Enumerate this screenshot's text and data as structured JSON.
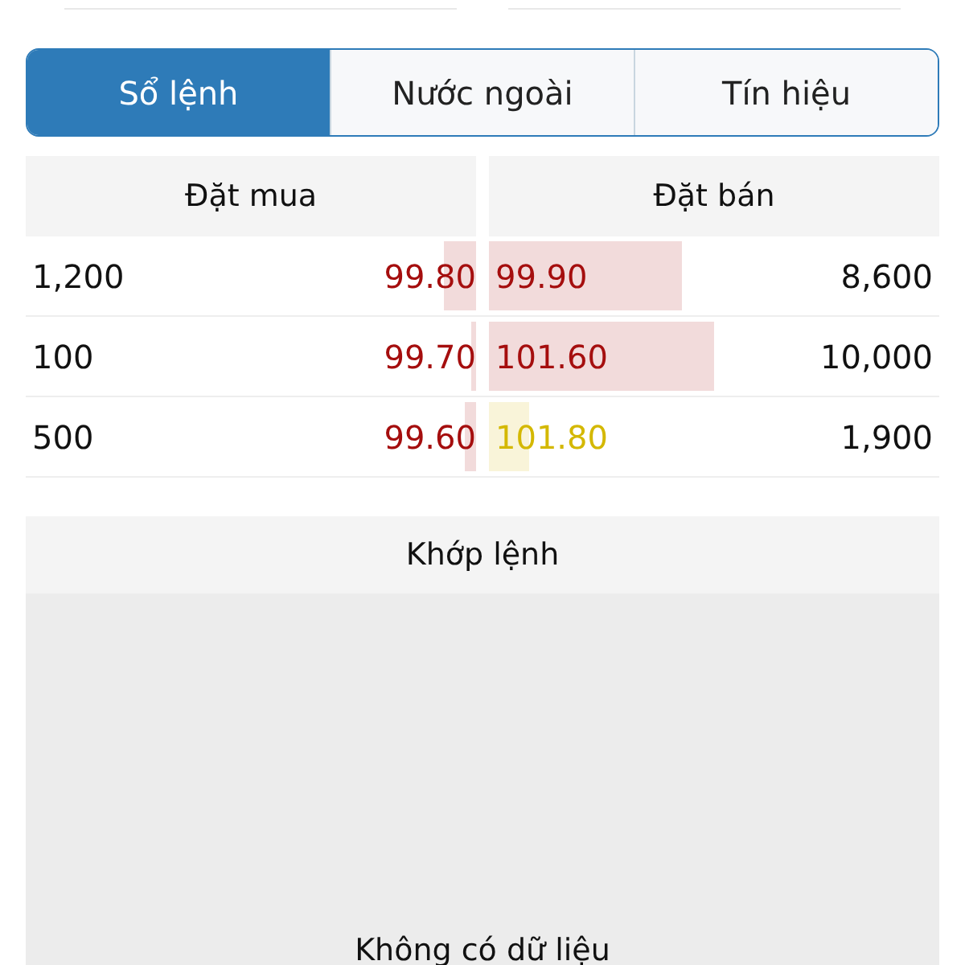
{
  "tabs": [
    {
      "label": "Sổ lệnh",
      "selected": true
    },
    {
      "label": "Nước ngoài",
      "selected": false
    },
    {
      "label": "Tín hiệu",
      "selected": false
    }
  ],
  "order_book": {
    "buy_header": "Đặt mua",
    "sell_header": "Đặt bán",
    "rows": [
      {
        "buy": {
          "volume": "1,200",
          "price": "99.80",
          "color": "#a50e0e",
          "level": 0.07
        },
        "sell": {
          "price": "99.90",
          "color": "#a50e0e",
          "level": 0.43,
          "volume": "8,600"
        }
      },
      {
        "buy": {
          "volume": "100",
          "price": "99.70",
          "color": "#a50e0e",
          "level": 0.01
        },
        "sell": {
          "price": "101.60",
          "color": "#a50e0e",
          "level": 0.5,
          "volume": "10,000"
        }
      },
      {
        "buy": {
          "volume": "500",
          "price": "99.60",
          "color": "#a50e0e",
          "level": 0.025
        },
        "sell": {
          "price": "101.80",
          "color": "#d4b800",
          "level": 0.09,
          "volume": "1,900"
        }
      }
    ]
  },
  "matched": {
    "title": "Khớp lệnh",
    "empty_text": "Không có dữ liệu"
  }
}
